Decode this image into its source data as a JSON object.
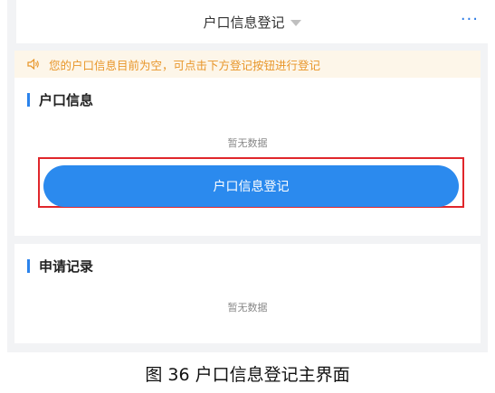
{
  "header": {
    "title": "户口信息登记",
    "more_label": "···"
  },
  "notice": {
    "icon": "speaker-icon",
    "text": "您的户口信息目前为空，可点击下方登记按钮进行登记"
  },
  "household_section": {
    "title": "户口信息",
    "empty_text": "暂无数据",
    "button_label": "户口信息登记"
  },
  "records_section": {
    "title": "申请记录",
    "empty_text": "暂无数据"
  },
  "caption": "图 36 户口信息登记主界面",
  "colors": {
    "accent": "#2b8aee",
    "notice_text": "#e8962a",
    "notice_bg": "#fdf6e9",
    "highlight": "#e0262b"
  }
}
